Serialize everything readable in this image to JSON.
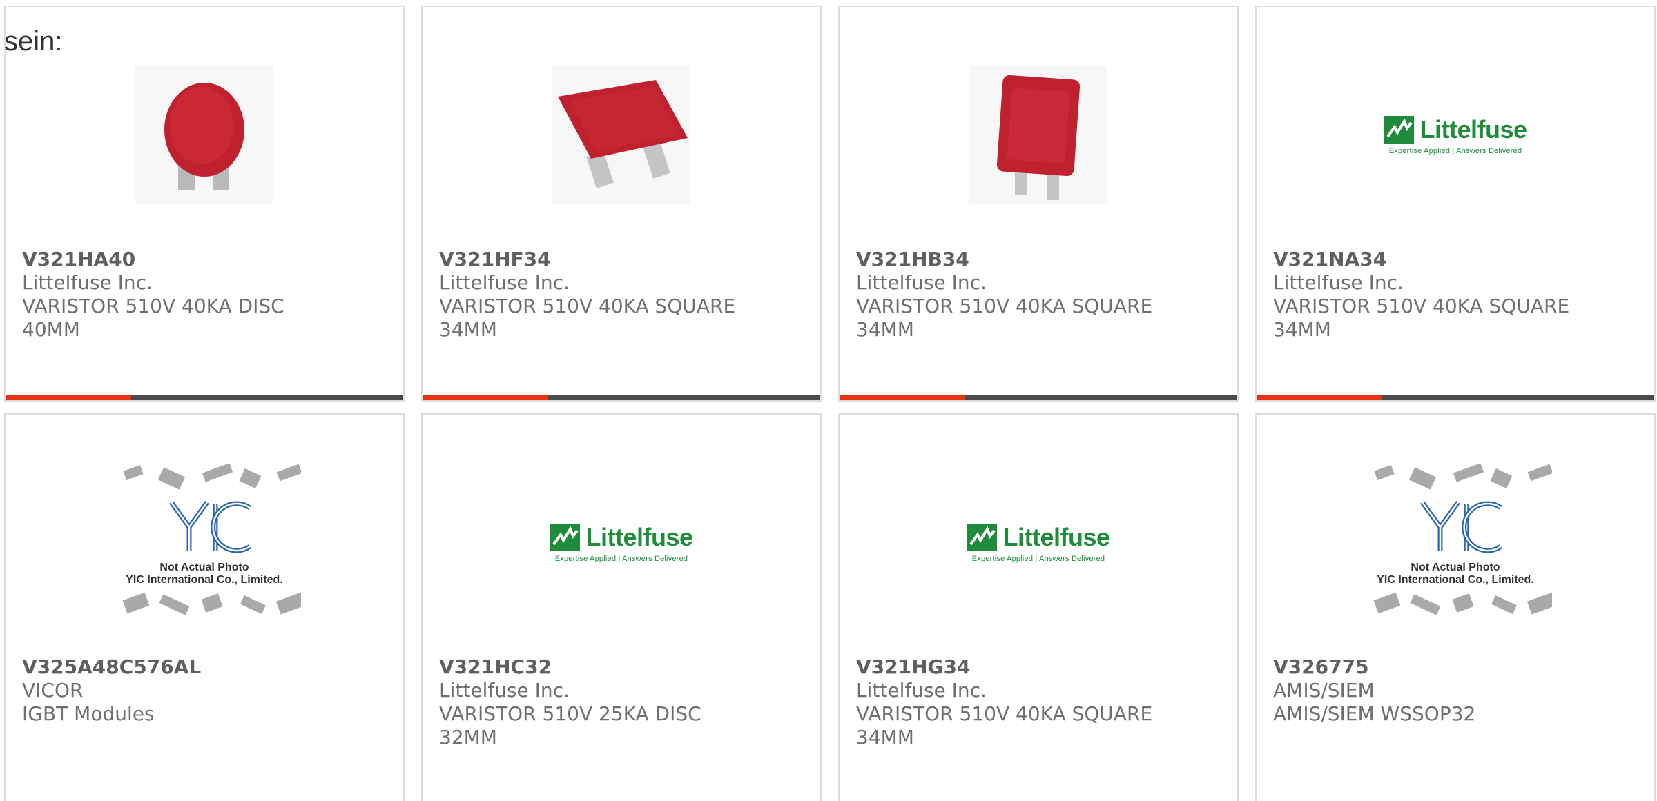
{
  "intro_text": "sein:",
  "colors": {
    "accent": "#e63312",
    "bar": "#4a4a4a",
    "littelfuse_green": "#1f8c3b",
    "component_red": "#c0212f",
    "yic_blue": "#2a64b4"
  },
  "products": [
    {
      "part": "V321HA40",
      "manufacturer": "Littelfuse Inc.",
      "description": "VARISTOR 510V 40KA DISC\n40MM",
      "image": "red-disc-varistor-photo"
    },
    {
      "part": "V321HF34",
      "manufacturer": "Littelfuse Inc.",
      "description": "VARISTOR 510V 40KA SQUARE\n34MM",
      "image": "red-square-varistor-photo"
    },
    {
      "part": "V321HB34",
      "manufacturer": "Littelfuse Inc.",
      "description": "VARISTOR 510V 40KA SQUARE\n34MM",
      "image": "red-square-varistor-upright-photo"
    },
    {
      "part": "V321NA34",
      "manufacturer": "Littelfuse Inc.",
      "description": "VARISTOR 510V 40KA SQUARE\n34MM",
      "image": "littelfuse-logo"
    },
    {
      "part": "V325A48C576AL",
      "manufacturer": "VICOR",
      "description": "IGBT Modules",
      "image": "yic-placeholder"
    },
    {
      "part": "V321HC32",
      "manufacturer": "Littelfuse Inc.",
      "description": "VARISTOR 510V 25KA DISC\n32MM",
      "image": "littelfuse-logo"
    },
    {
      "part": "V321HG34",
      "manufacturer": "Littelfuse Inc.",
      "description": "VARISTOR 510V 40KA SQUARE\n34MM",
      "image": "littelfuse-logo"
    },
    {
      "part": "V326775",
      "manufacturer": "AMIS/SIEM",
      "description": "AMIS/SIEM WSSOP32",
      "image": "yic-placeholder"
    }
  ],
  "littelfuse_logo": {
    "word": "Littelfuse",
    "tagline": "Expertise Applied | Answers Delivered"
  },
  "yic_placeholder": {
    "logo_text": "YIC",
    "line1": "Not Actual Photo",
    "line2": "YIC International Co., Limited."
  }
}
